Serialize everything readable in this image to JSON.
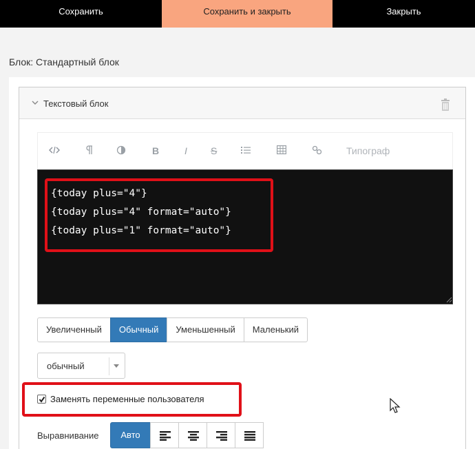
{
  "topbar": {
    "save_label": "Сохранить",
    "save_close_label": "Сохранить и закрыть",
    "close_label": "Закрыть"
  },
  "block_title": "Блок: Стандартный блок",
  "panel": {
    "title": "Текстовый блок",
    "chevron_icon": "chevron-down-icon",
    "delete_icon": "trash-icon"
  },
  "toolbar": {
    "items": [
      {
        "icon": "code-icon"
      },
      {
        "icon": "paragraph-icon"
      },
      {
        "icon": "contrast-icon"
      },
      {
        "icon": "bold-icon",
        "label": "B"
      },
      {
        "icon": "italic-icon",
        "label": "I"
      },
      {
        "icon": "strikethrough-icon",
        "label": "S"
      },
      {
        "icon": "list-icon"
      },
      {
        "icon": "table-icon"
      },
      {
        "icon": "link-icon"
      },
      {
        "icon": "typograph",
        "label": "Типограф"
      }
    ]
  },
  "editor": {
    "lines": [
      "{today plus=\"4\"}",
      "{today plus=\"4\" format=\"auto\"}",
      "{today plus=\"1\" format=\"auto\"}"
    ]
  },
  "size_buttons": [
    {
      "label": "Увеличенный",
      "active": false
    },
    {
      "label": "Обычный",
      "active": true
    },
    {
      "label": "Уменьшенный",
      "active": false
    },
    {
      "label": "Маленький",
      "active": false
    }
  ],
  "style_select": {
    "value": "обычный"
  },
  "replace_vars": {
    "label": "Заменять переменные пользователя",
    "checked": true
  },
  "alignment": {
    "label": "Выравнивание",
    "auto_label": "Авто",
    "options": [
      "align-left-icon",
      "align-center-icon",
      "align-right-icon",
      "align-justify-icon"
    ]
  },
  "colors": {
    "accent": "#f9a57f",
    "primary": "#337ab7",
    "highlight": "#e01018",
    "editor_bg": "#111111"
  }
}
